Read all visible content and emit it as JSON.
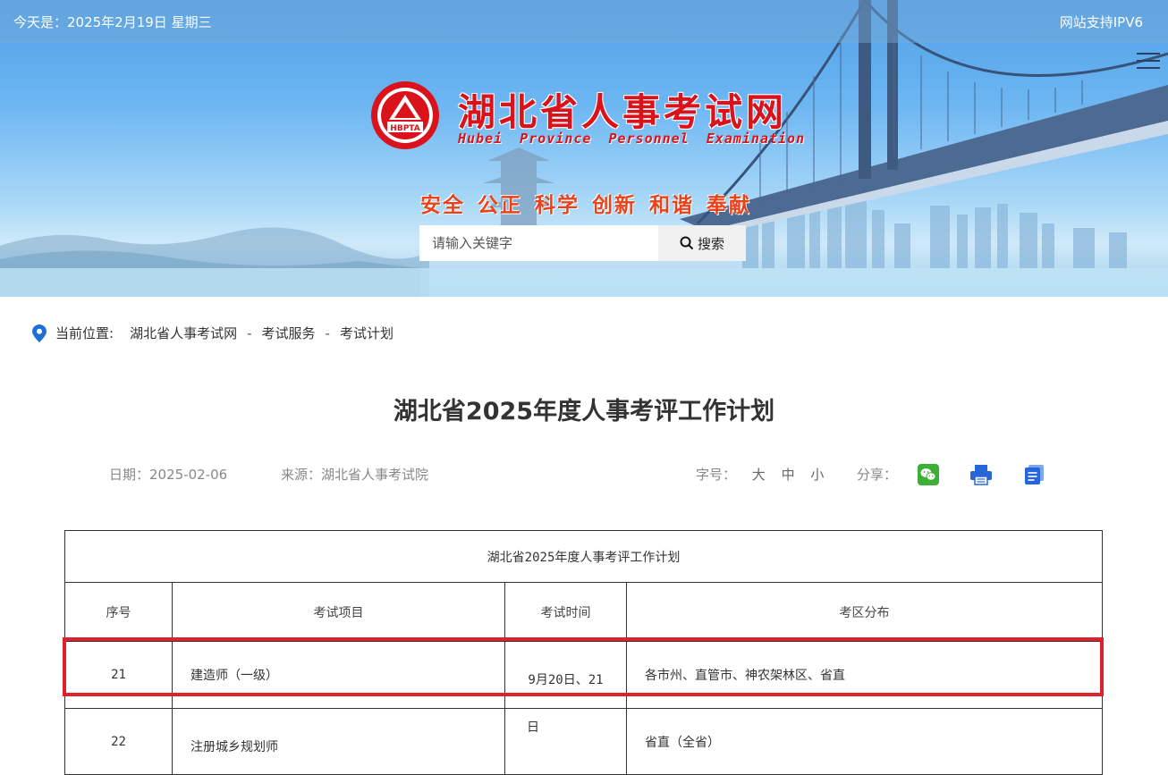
{
  "header": {
    "date_text": "今天是：2025年2月19日 星期三",
    "ipv6_text": "网站支持IPV6",
    "site_name": "湖北省人事考试网",
    "site_name_en": "Hubei Province Personnel Examination",
    "logo_text": "HBPTA",
    "slogan": "安全 公正 科学 创新 和谐 奉献",
    "search": {
      "placeholder": "请输入关键字",
      "button_label": "搜索"
    },
    "menu_icon": "hamburger-menu-icon"
  },
  "breadcrumb": {
    "label": "当前位置:",
    "items": [
      "湖北省人事考试网",
      "考试服务",
      "考试计划"
    ],
    "separator": "-"
  },
  "article": {
    "title": "湖北省2025年度人事考评工作计划",
    "date": "日期：2025-02-06",
    "source": "来源：湖北省人事考试院",
    "font_size_label": "字号：",
    "font_sizes": [
      "大",
      "中",
      "小"
    ],
    "share_label": "分享：",
    "share_icons": [
      "wechat-icon",
      "print-icon",
      "copy-icon"
    ]
  },
  "table": {
    "caption": "湖北省2025年度人事考评工作计划",
    "headers": [
      "序号",
      "考试项目",
      "考试时间",
      "考区分布"
    ],
    "rows": [
      {
        "no": "21",
        "item": "建造师（一级）",
        "time": "9月20日、21",
        "area": "各市州、直管市、神农架林区、省直"
      },
      {
        "no": "22",
        "item": "注册城乡规划师",
        "time": "日",
        "area": "省直（全省）"
      }
    ]
  },
  "colors": {
    "highlight": "#e0202c",
    "brand_red": "#d9121b",
    "slogan": "#e8431b"
  }
}
